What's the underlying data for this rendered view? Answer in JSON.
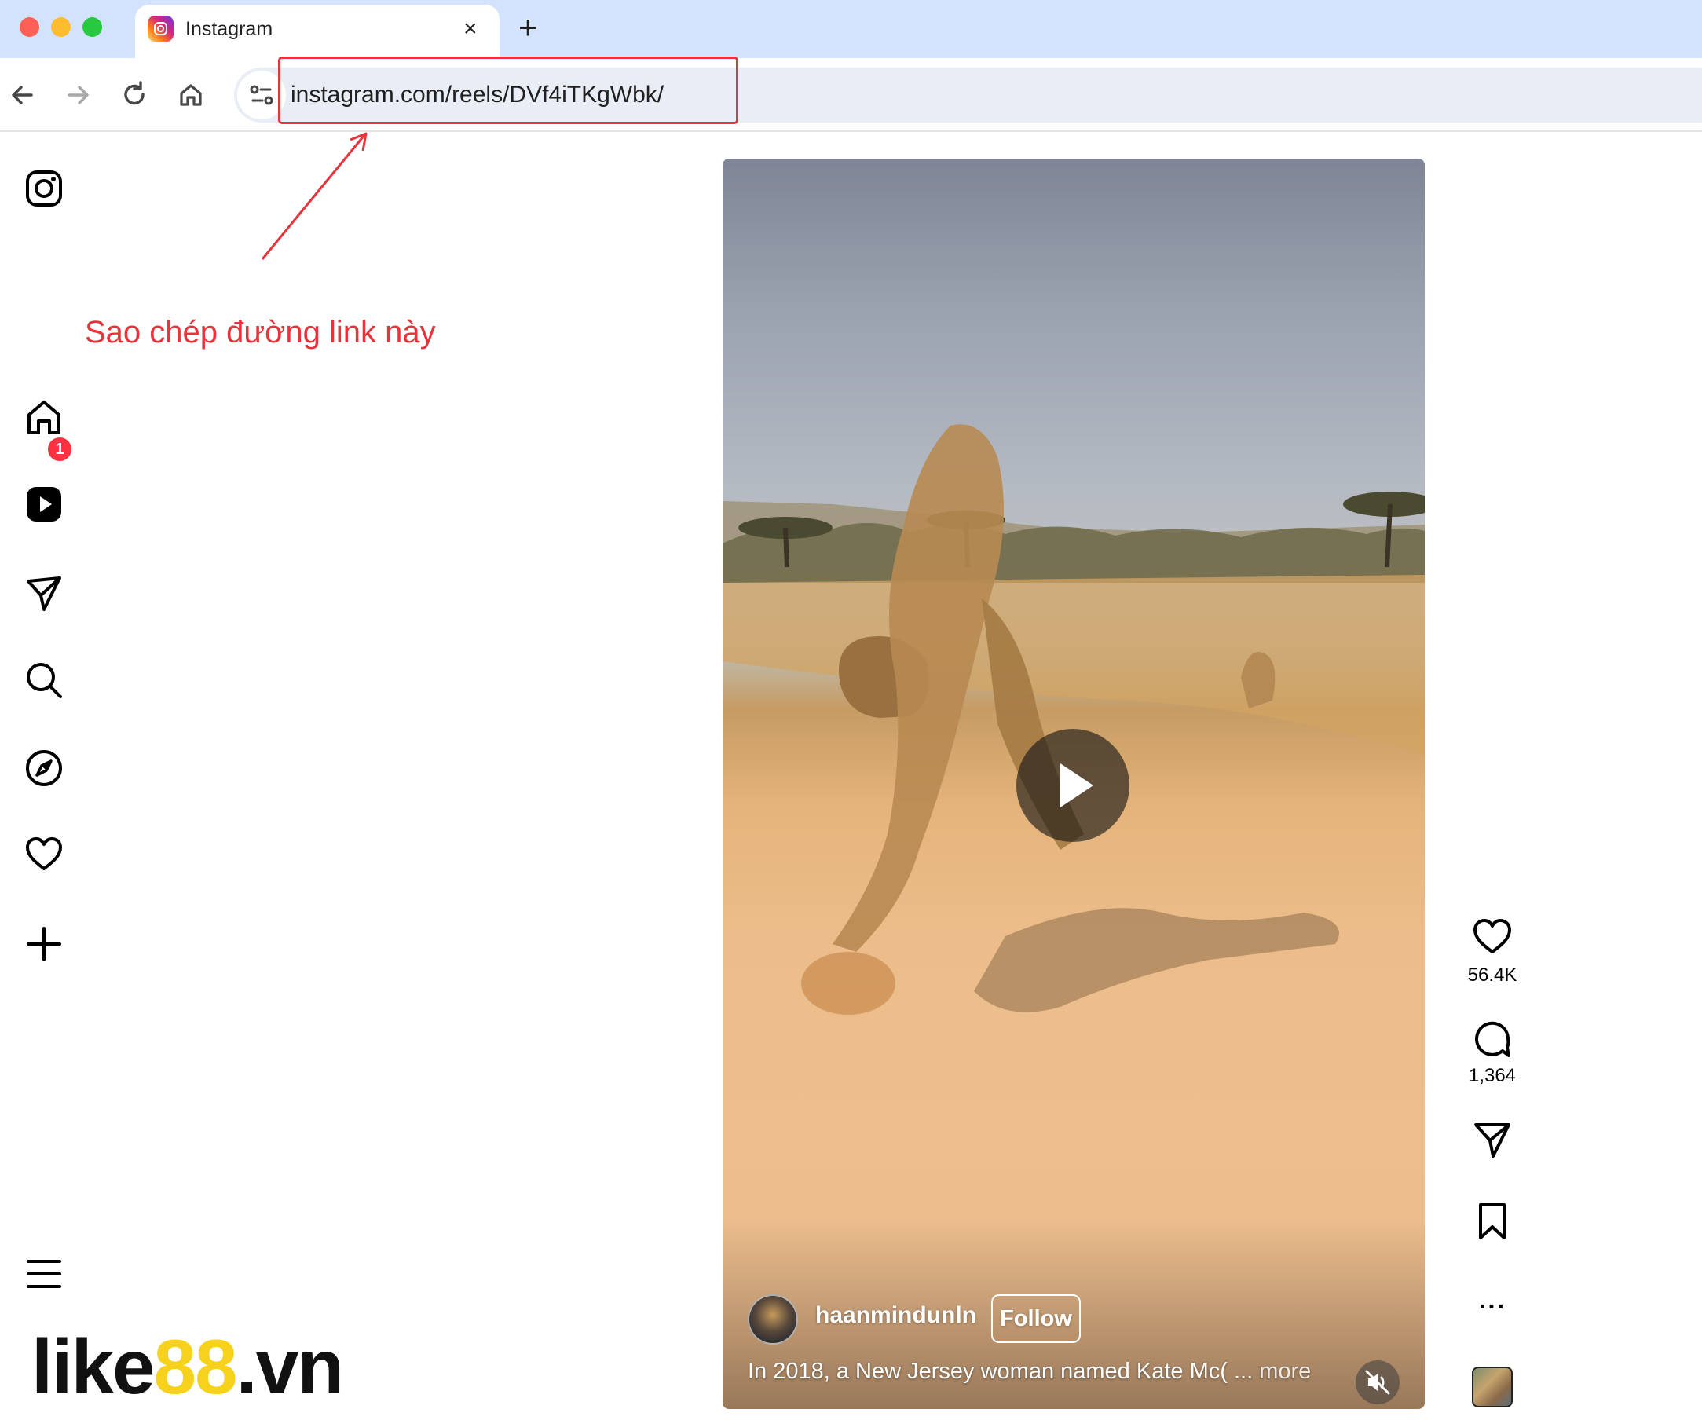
{
  "browser": {
    "tab": {
      "title": "Instagram",
      "close_icon": "×",
      "favicon": "instagram-icon"
    },
    "new_tab_label": "+",
    "toolbar": {
      "back_icon": "arrow-left-icon",
      "forward_icon": "arrow-right-icon",
      "reload_icon": "reload-icon",
      "home_icon": "home-icon",
      "site_info_icon": "tune-icon"
    },
    "url": "instagram.com/reels/DVf4iTKgWbk/"
  },
  "annotation": {
    "text": "Sao chép đường link này",
    "color": "#e8333a"
  },
  "sidebar": {
    "items": [
      {
        "name": "instagram-logo",
        "icon": "instagram-icon"
      },
      {
        "name": "home",
        "icon": "home-icon"
      },
      {
        "name": "reels",
        "icon": "reels-icon"
      },
      {
        "name": "messages",
        "icon": "messenger-icon",
        "badge": "1"
      },
      {
        "name": "search",
        "icon": "search-icon"
      },
      {
        "name": "explore",
        "icon": "compass-icon"
      },
      {
        "name": "notifications",
        "icon": "heart-icon"
      },
      {
        "name": "create",
        "icon": "plus-icon"
      },
      {
        "name": "more",
        "icon": "menu-icon"
      }
    ]
  },
  "reel": {
    "username": "haanmindunln",
    "follow_label": "Follow",
    "caption": "In 2018, a New Jersey woman named Kate Mc( ...",
    "more_label": "more",
    "likes": "56.4K",
    "comments": "1,364",
    "actions": [
      "heart-icon",
      "comment-icon",
      "share-icon",
      "bookmark-icon",
      "more-icon"
    ],
    "ellipsis": "..."
  },
  "watermark": {
    "part1": "like",
    "part2": "88",
    "part3": ".vn",
    "accent": "#f7d21c"
  }
}
